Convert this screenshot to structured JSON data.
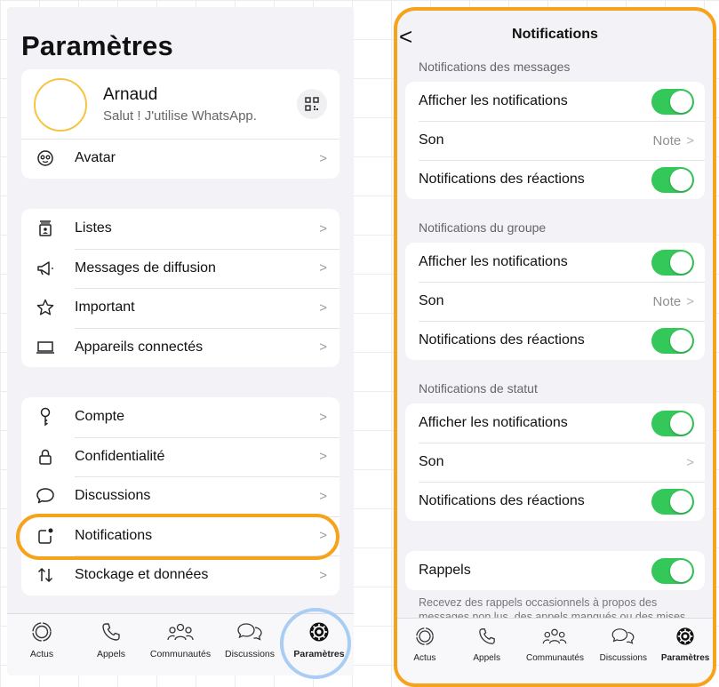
{
  "left": {
    "title": "Paramètres",
    "profile": {
      "name": "Arnaud",
      "status": "Salut ! J'utilise WhatsApp."
    },
    "avatar_row": {
      "label": "Avatar",
      "icon": "avatar-face-icon"
    },
    "group1": [
      {
        "label": "Listes",
        "icon": "lists-icon"
      },
      {
        "label": "Messages de diffusion",
        "icon": "megaphone-icon"
      },
      {
        "label": "Important",
        "icon": "star-icon"
      },
      {
        "label": "Appareils connectés",
        "icon": "laptop-icon"
      }
    ],
    "group2": [
      {
        "label": "Compte",
        "icon": "key-icon"
      },
      {
        "label": "Confidentialité",
        "icon": "lock-icon"
      },
      {
        "label": "Discussions",
        "icon": "chat-bubble-icon"
      },
      {
        "label": "Notifications",
        "icon": "notification-icon"
      },
      {
        "label": "Stockage et données",
        "icon": "arrows-updown-icon"
      }
    ],
    "chevron": ">",
    "tabs": [
      {
        "label": "Actus",
        "icon": "updates-icon"
      },
      {
        "label": "Appels",
        "icon": "phone-icon"
      },
      {
        "label": "Communautés",
        "icon": "communities-icon"
      },
      {
        "label": "Discussions",
        "icon": "chats-icon"
      },
      {
        "label": "Paramètres",
        "icon": "settings-icon",
        "active": true
      }
    ]
  },
  "right": {
    "back": "<",
    "title": "Notifications",
    "sections": [
      {
        "header": "Notifications des messages",
        "show_label": "Afficher les notifications",
        "sound_label": "Son",
        "sound_value": "Note",
        "reactions_label": "Notifications des réactions"
      },
      {
        "header": "Notifications du groupe",
        "show_label": "Afficher les notifications",
        "sound_label": "Son",
        "sound_value": "Note",
        "reactions_label": "Notifications des réactions"
      },
      {
        "header": "Notifications de statut",
        "show_label": "Afficher les notifications",
        "sound_label": "Son",
        "sound_value": "",
        "reactions_label": "Notifications des réactions"
      }
    ],
    "reminders_label": "Rappels",
    "reminders_note": "Recevez des rappels occasionnels à propos des messages non lus, des appels manqués ou des mises",
    "toggle_color": "#34c759",
    "tabs": [
      {
        "label": "Actus"
      },
      {
        "label": "Appels"
      },
      {
        "label": "Communautés"
      },
      {
        "label": "Discussions"
      },
      {
        "label": "Paramètres",
        "active": true
      }
    ]
  },
  "highlight_color": "#f7a21b",
  "highlight_tab_color": "#a9cdf3"
}
